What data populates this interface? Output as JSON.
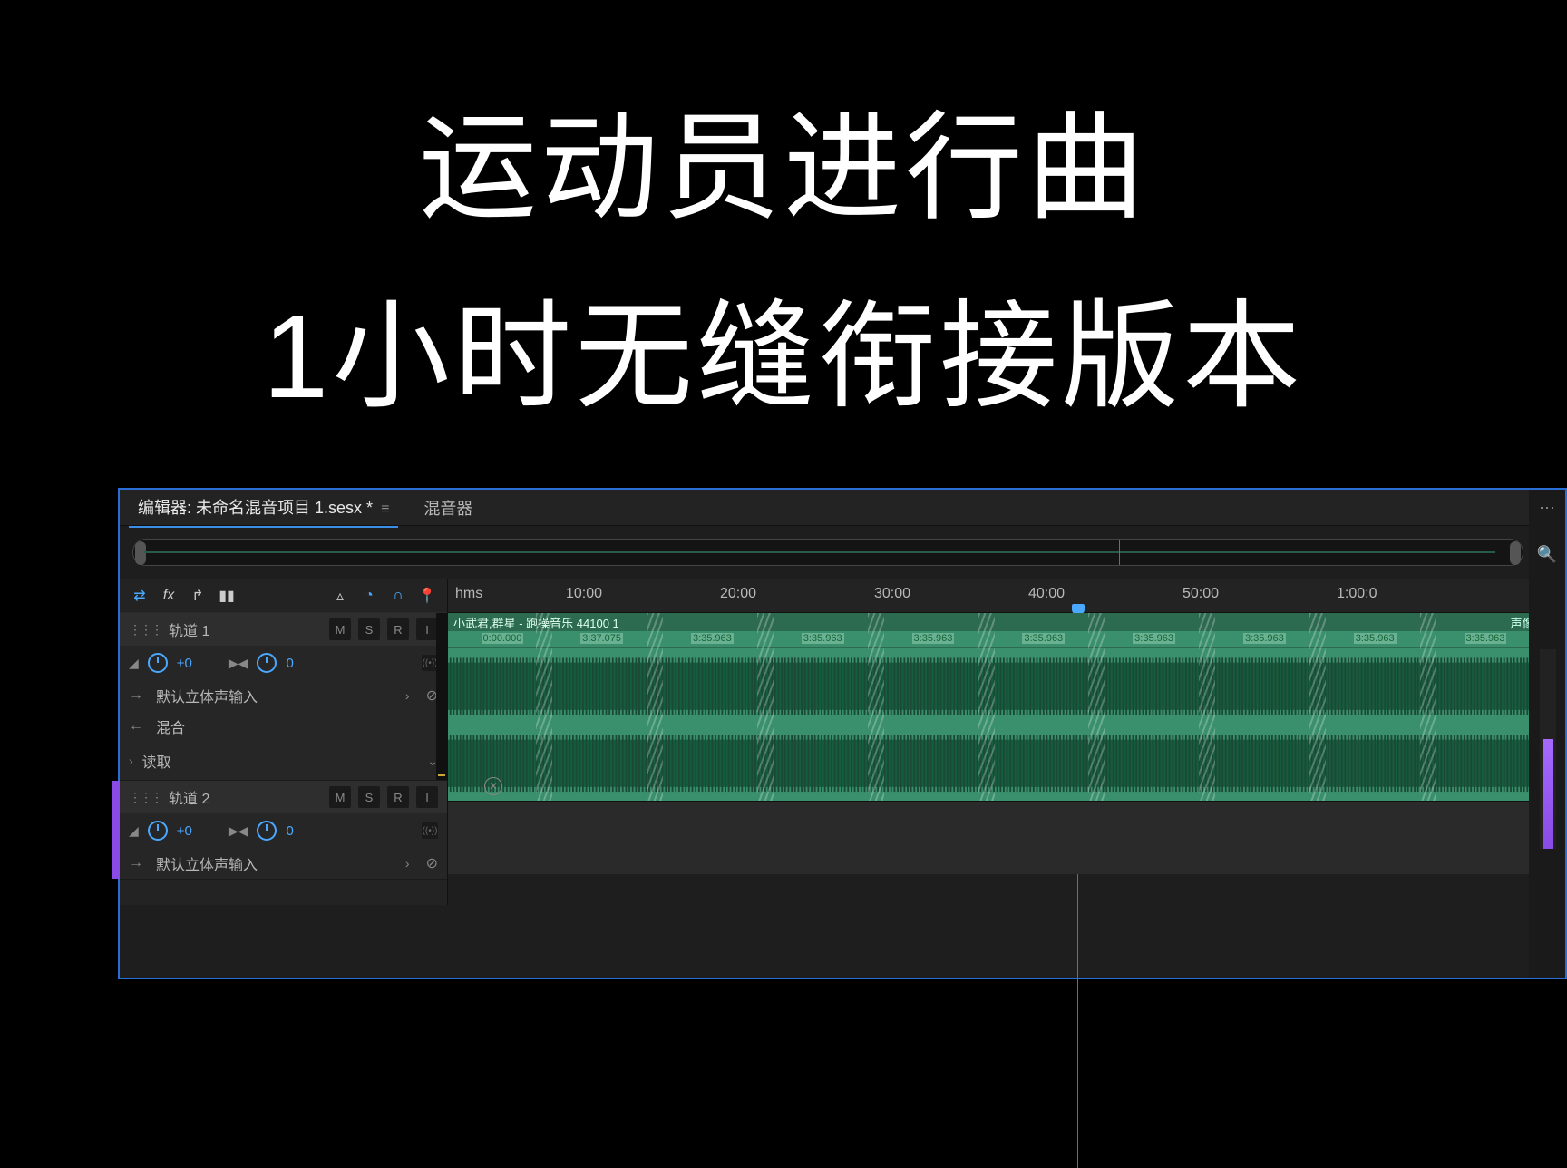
{
  "title": {
    "line1": "运动员进行曲",
    "line2": "1小时无缝衔接版本"
  },
  "tabs": {
    "editor_prefix": "编辑器:",
    "editor_file": "未命名混音项目 1.sesx *",
    "mixer": "混音器"
  },
  "ruler": {
    "unit": "hms",
    "marks": [
      "10:00",
      "20:00",
      "30:00",
      "40:00",
      "50:00",
      "1:00:0"
    ],
    "playhead_percent": 56
  },
  "track1": {
    "name": "轨道 1",
    "mute": "M",
    "solo": "S",
    "record": "R",
    "input_mon": "I",
    "vol": "+0",
    "pan": "0",
    "input": "默认立体声输入",
    "output": "混合",
    "automation": "读取",
    "clip": {
      "title": "小武君,群星 - 跑操音乐 44100 1",
      "pan_label": "声像",
      "markers": [
        "0:00.000",
        "3:37.075",
        "3:35.963",
        "3:35.963",
        "3:35.963",
        "3:35.963",
        "3:35.963",
        "3:35.963",
        "3:35.963",
        "3:35.963"
      ]
    }
  },
  "track2": {
    "name": "轨道 2",
    "mute": "M",
    "solo": "S",
    "record": "R",
    "input_mon": "I",
    "vol": "+0",
    "pan": "0",
    "input": "默认立体声输入"
  },
  "colors": {
    "accent_blue": "#4aa8ff",
    "waveform": "#3a8f6c",
    "purple": "#8a4ae6"
  }
}
